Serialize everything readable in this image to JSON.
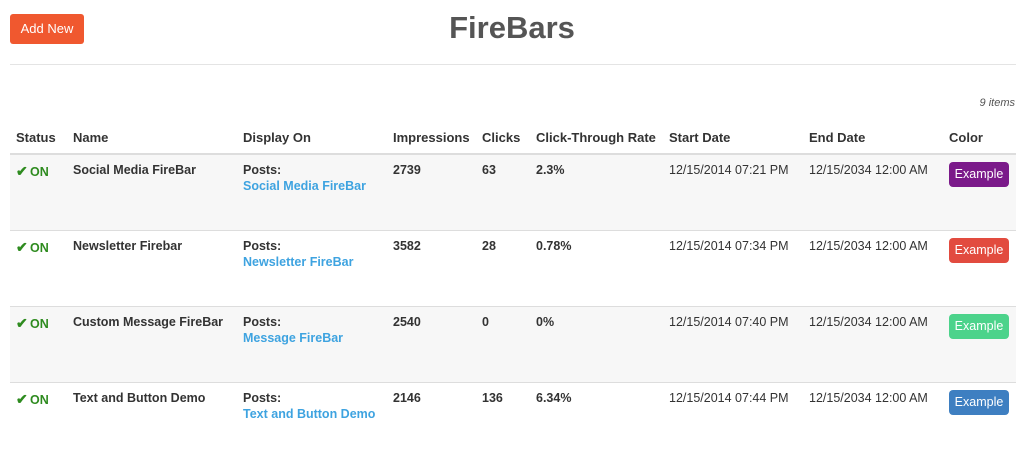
{
  "header": {
    "add_new_label": "Add New",
    "title": "FireBars"
  },
  "item_count": "9 items",
  "columns": [
    "Status",
    "Name",
    "Display On",
    "Impressions",
    "Clicks",
    "Click-Through Rate",
    "Start Date",
    "End Date",
    "Color"
  ],
  "rows": [
    {
      "status": "ON",
      "name": "Social Media FireBar",
      "display_label": "Posts:",
      "display_link": "Social Media FireBar",
      "impressions": "2739",
      "clicks": "63",
      "ctr": "2.3%",
      "start": "12/15/2014 07:21 PM",
      "end": "12/15/2034 12:00 AM",
      "color_label": "Example",
      "color": "#7b1a8a"
    },
    {
      "status": "ON",
      "name": "Newsletter Firebar",
      "display_label": "Posts:",
      "display_link": "Newsletter FireBar",
      "impressions": "3582",
      "clicks": "28",
      "ctr": "0.78%",
      "start": "12/15/2014 07:34 PM",
      "end": "12/15/2034 12:00 AM",
      "color_label": "Example",
      "color": "#e24b3f"
    },
    {
      "status": "ON",
      "name": "Custom Message FireBar",
      "display_label": "Posts:",
      "display_link": "Message FireBar",
      "impressions": "2540",
      "clicks": "0",
      "ctr": "0%",
      "start": "12/15/2014 07:40 PM",
      "end": "12/15/2034 12:00 AM",
      "color_label": "Example",
      "color": "#4cd38b"
    },
    {
      "status": "ON",
      "name": "Text and Button Demo",
      "display_label": "Posts:",
      "display_link": "Text and Button Demo",
      "impressions": "2146",
      "clicks": "136",
      "ctr": "6.34%",
      "start": "12/15/2014 07:44 PM",
      "end": "12/15/2034 12:00 AM",
      "color_label": "Example",
      "color": "#3e7fc1"
    }
  ],
  "icons": {
    "status_on": "checkmark-icon"
  }
}
